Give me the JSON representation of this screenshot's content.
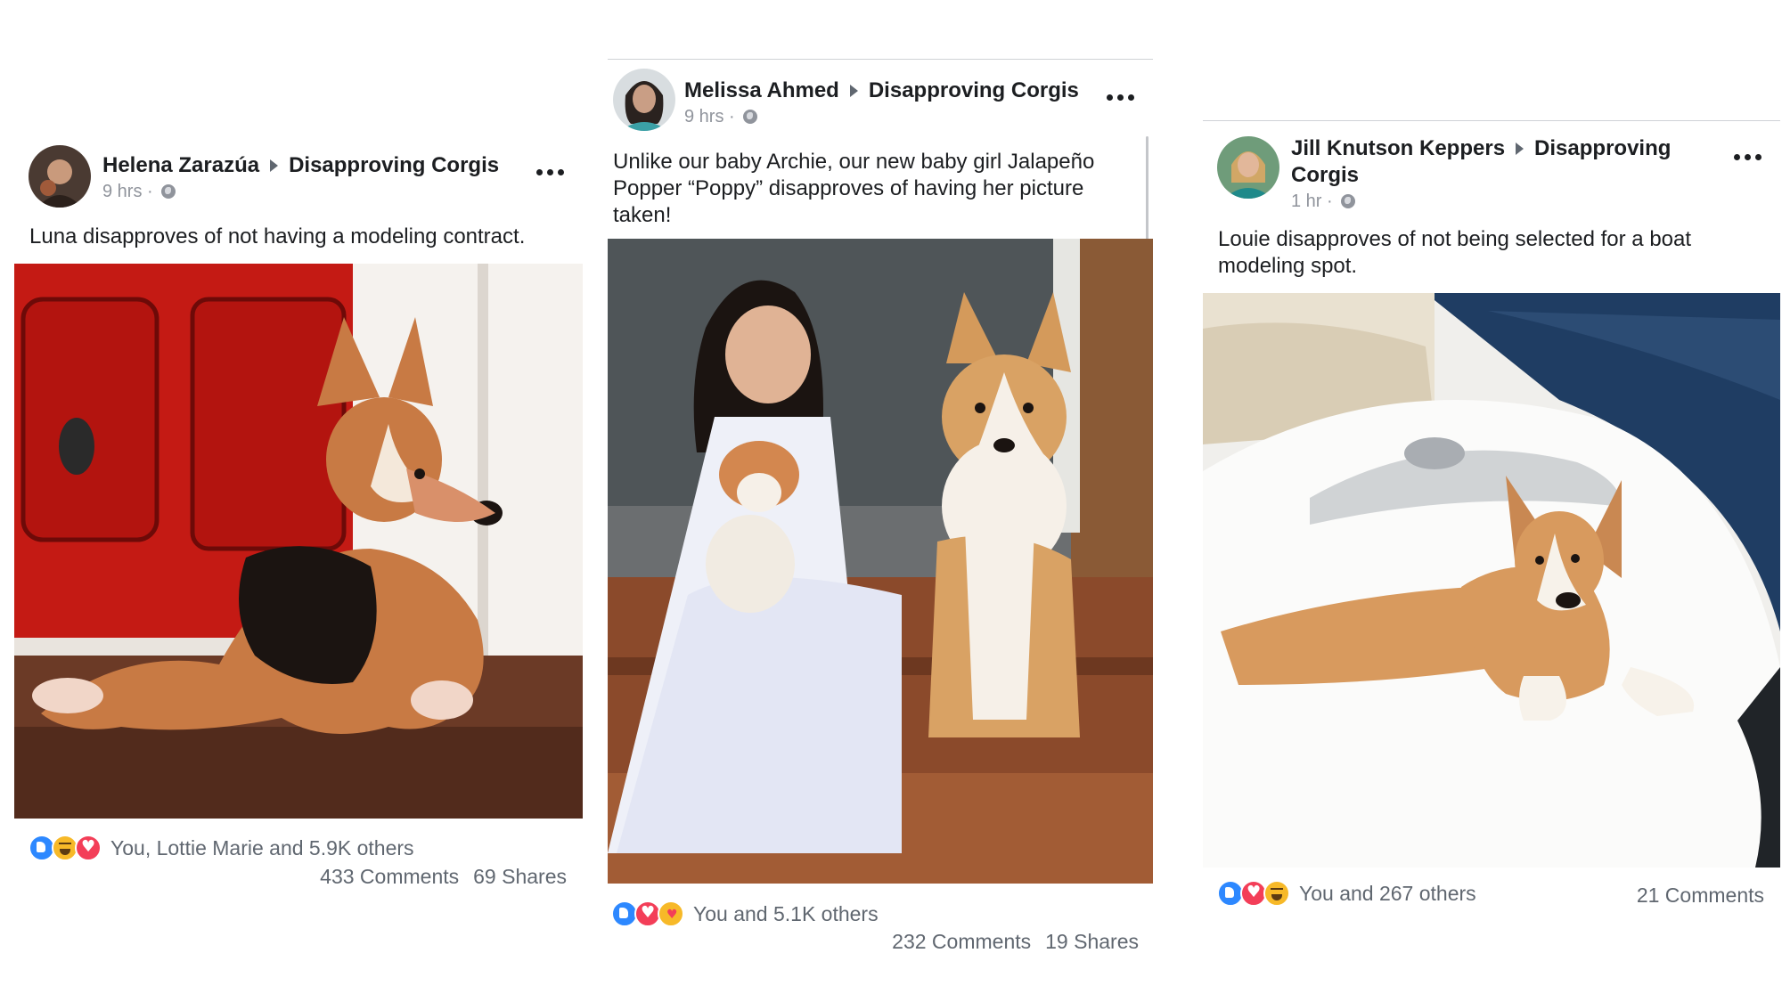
{
  "posts": [
    {
      "author": "Helena Zarazúa",
      "group": "Disapproving Corgis",
      "time": "9 hrs",
      "caption": "Luna disapproves of not having a modeling contract.",
      "reaction_icons": [
        "like-icon",
        "haha-icon",
        "love-icon"
      ],
      "reactions_text": "You, Lottie Marie and 5.9K others",
      "comments": "433 Comments",
      "shares": "69 Shares"
    },
    {
      "author": "Melissa Ahmed",
      "group": "Disapproving Corgis",
      "time": "9 hrs",
      "caption": "Unlike our baby Archie, our new baby girl Jalapeño Popper “Poppy” disapproves of having her picture taken!",
      "reaction_icons": [
        "like-icon",
        "love-icon",
        "care-icon"
      ],
      "reactions_text": "You and 5.1K others",
      "comments": "232 Comments",
      "shares": "19 Shares"
    },
    {
      "author": "Jill Knutson Keppers",
      "group": "Disapproving Corgis",
      "time": "1 hr",
      "caption": "Louie disapproves of not being selected for a boat modeling spot.",
      "reaction_icons": [
        "like-icon",
        "love-icon",
        "haha-icon"
      ],
      "reactions_text": "You and 267 others",
      "comments": "21 Comments"
    }
  ],
  "colors": {
    "text": "#1c1e21",
    "meta": "#90949c",
    "secondary": "#606770",
    "like": "#2d88ff",
    "love": "#f33e58",
    "haha": "#f7b928"
  }
}
